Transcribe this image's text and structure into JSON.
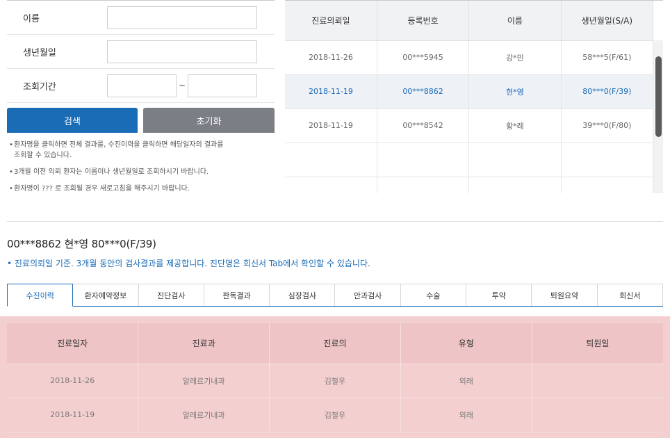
{
  "search_form": {
    "name_label": "이름",
    "dob_label": "생년월일",
    "period_label": "조회기간",
    "period_separator": "~",
    "name_value": "",
    "dob_value": "",
    "period_from": "",
    "period_to": "",
    "search_button": "검색",
    "reset_button": "초기화",
    "notes": [
      "환자명을 클릭하면 전체 결과를, 수진이력을 클릭하면 해당일자의 결과를\n조회할 수 있습니다.",
      "3개월 이전 의뢰 환자는 이름이나 생년월일로 조회하시기 바랍니다.",
      "환자명이 ??? 로 조회될 경우 새로고침을 해주시기 바랍니다."
    ]
  },
  "results": {
    "columns": [
      "진료의뢰일",
      "등록번호",
      "이름",
      "생년월일(S/A)"
    ],
    "rows": [
      [
        "2018-11-26",
        "00***5945",
        "강*민",
        "58***5(F/61)"
      ],
      [
        "2018-11-19",
        "00***8862",
        "현*영",
        "80***0(F/39)"
      ],
      [
        "2018-11-19",
        "00***8542",
        "황*례",
        "39***0(F/80)"
      ],
      [
        "",
        "",
        "",
        ""
      ],
      [
        "",
        "",
        "",
        ""
      ]
    ],
    "selected_index": 1
  },
  "patient": {
    "summary": "00***8862 현*영 80***0(F/39)",
    "info": "• 진료의뢰일 기준. 3개월 동안의 검사결과를 제공합니다. 진단명은 회신서 Tab에서 확인할 수 있습니다."
  },
  "tabs": {
    "items": [
      "수진이력",
      "환자예약정보",
      "진단검사",
      "판독결과",
      "심장검사",
      "안과검사",
      "수술",
      "투약",
      "퇴원요약",
      "회신서"
    ],
    "active_index": 0
  },
  "history": {
    "columns": [
      "진료일자",
      "진료과",
      "진료의",
      "유형",
      "퇴원일"
    ],
    "rows": [
      [
        "2018-11-26",
        "알레르기내과",
        "김철우",
        "외래",
        ""
      ],
      [
        "2018-11-19",
        "알레르기내과",
        "김철우",
        "외래",
        ""
      ]
    ],
    "highlight_color": "#f4cfd0"
  },
  "colors": {
    "primary": "#1a6cb7",
    "reset": "#7b7f85"
  }
}
